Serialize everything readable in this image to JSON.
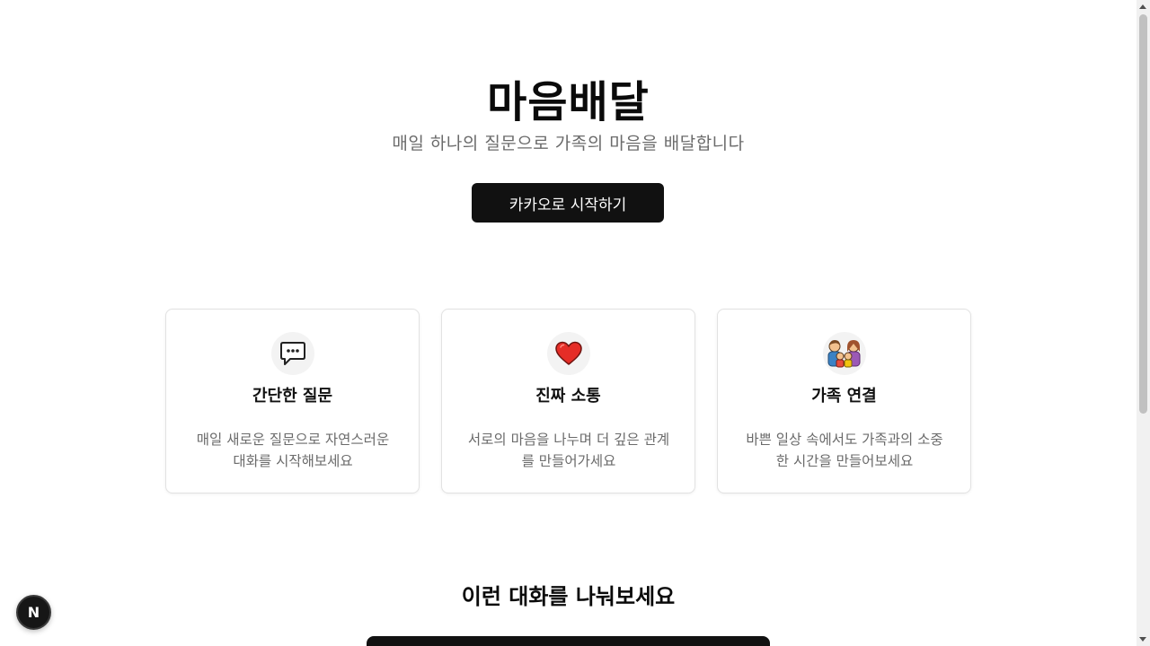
{
  "hero": {
    "title": "마음배달",
    "subtitle": "매일 하나의 질문으로 가족의 마음을 배달합니다",
    "cta_label": "카카오로 시작하기"
  },
  "features": [
    {
      "icon": "speech-bubble-icon",
      "title": "간단한 질문",
      "description": "매일 새로운 질문으로 자연스러운 대화를 시작해보세요"
    },
    {
      "icon": "red-heart-icon",
      "title": "진짜 소통",
      "description": "서로의 마음을 나누며 더 깊은 관계를 만들어가세요"
    },
    {
      "icon": "family-icon",
      "title": "가족 연결",
      "description": "바쁜 일상 속에서도 가족과의 소중한 시간을 만들어보세요"
    }
  ],
  "section": {
    "title": "이런 대화를 나눠보세요"
  },
  "dev_badge": {
    "label": "N"
  },
  "colors": {
    "primary_button": "#111111",
    "heart": "#e52d27",
    "text_muted": "#6b6b6b"
  }
}
